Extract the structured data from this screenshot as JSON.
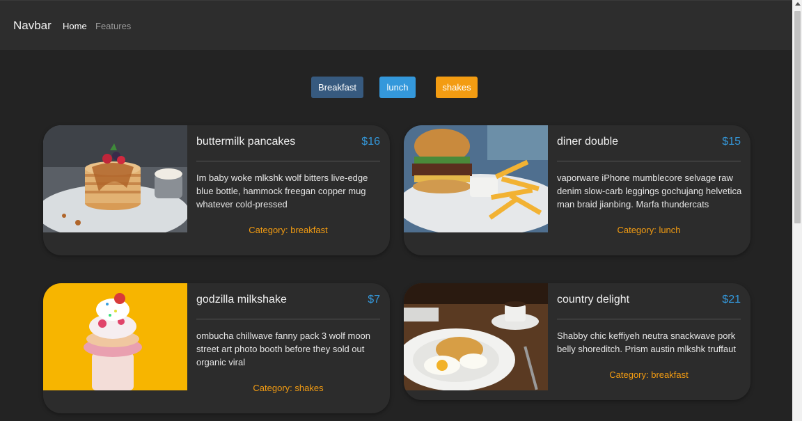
{
  "navbar": {
    "brand": "Navbar",
    "links": [
      {
        "label": "Home",
        "active": true
      },
      {
        "label": "Features",
        "active": false
      }
    ]
  },
  "filters": [
    {
      "label": "Breakfast",
      "color": "#375a7f"
    },
    {
      "label": "lunch",
      "color": "#3498db"
    },
    {
      "label": "shakes",
      "color": "#f39c12"
    }
  ],
  "menu": [
    {
      "title": "buttermilk pancakes",
      "price": "$16",
      "description": "Im baby woke mlkshk wolf bitters live-edge blue bottle, hammock freegan copper mug whatever cold-pressed",
      "category": "Category: breakfast",
      "image": "pancakes"
    },
    {
      "title": "diner double",
      "price": "$15",
      "description": "vaporware iPhone mumblecore selvage raw denim slow-carb leggings gochujang helvetica man braid jianbing. Marfa thundercats",
      "category": "Category: lunch",
      "image": "burger-fries"
    },
    {
      "title": "godzilla milkshake",
      "price": "$7",
      "description": "ombucha chillwave fanny pack 3 wolf moon street art photo booth before they sold out organic viral",
      "category": "Category: shakes",
      "image": "milkshake"
    },
    {
      "title": "country delight",
      "price": "$21",
      "description": "Shabby chic keffiyeh neutra snackwave pork belly shoreditch. Prism austin mlkshk truffaut",
      "category": "Category: breakfast",
      "image": "eggs-toast"
    }
  ],
  "colors": {
    "background": "#232323",
    "card": "#2c2c2c",
    "price": "#3498db",
    "category": "#f39c12"
  }
}
